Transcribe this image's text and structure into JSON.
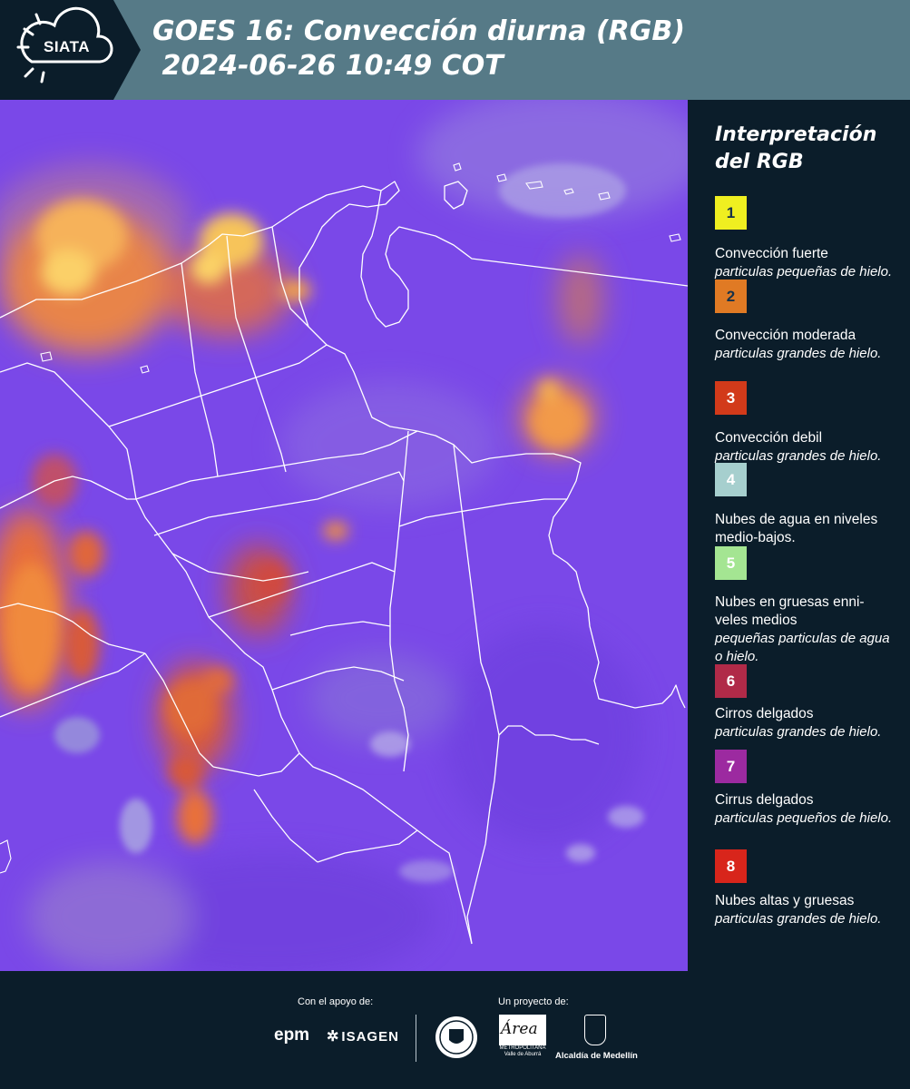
{
  "header": {
    "logo_text": "SIATA",
    "title_line1": "GOES 16: Convección diurna (RGB)",
    "title_line2": " 2024-06-26 10:49 COT"
  },
  "legend": {
    "title": "Interpretación del RGB",
    "items": [
      {
        "number": "1",
        "color": "#efef20",
        "name": "Convección fuerte",
        "detail": "particulas pequeñas de hielo."
      },
      {
        "number": "2",
        "color": "#e07a24",
        "name": "Convección moderada",
        "detail": "particulas grandes de hielo."
      },
      {
        "number": "3",
        "color": "#d23a1a",
        "name": "Convección debil",
        "detail": "particulas grandes de hielo."
      },
      {
        "number": "4",
        "color": "#a6cfce",
        "name": "Nubes de agua en niveles medio-bajos.",
        "detail": ""
      },
      {
        "number": "5",
        "color": "#a4e592",
        "name": "Nubes en gruesas enni-veles medios",
        "detail": "pequeñas particulas de agua o hielo."
      },
      {
        "number": "6",
        "color": "#b02a48",
        "name": "Cirros delgados",
        "detail": "particulas grandes de hielo."
      },
      {
        "number": "7",
        "color": "#9c2aa0",
        "name": "Cirrus delgados",
        "detail": "particulas pequeños de hielo."
      },
      {
        "number": "8",
        "color": "#d8251b",
        "name": "Nubes altas y gruesas",
        "detail": "particulas grandes de hielo."
      }
    ]
  },
  "footer": {
    "support_label": "Con el apoyo de:",
    "project_label": "Un proyecto de:",
    "epm": "epm",
    "isagen": "ISAGEN",
    "area_word": "Área",
    "area_caption": "METROPOLITANA Valle de Aburrá",
    "medellin": "Alcaldía de Medellín"
  },
  "colors": {
    "header_bg": "#567a87",
    "page_bg": "#0b1d2a",
    "map_base": "#7a48e8"
  }
}
